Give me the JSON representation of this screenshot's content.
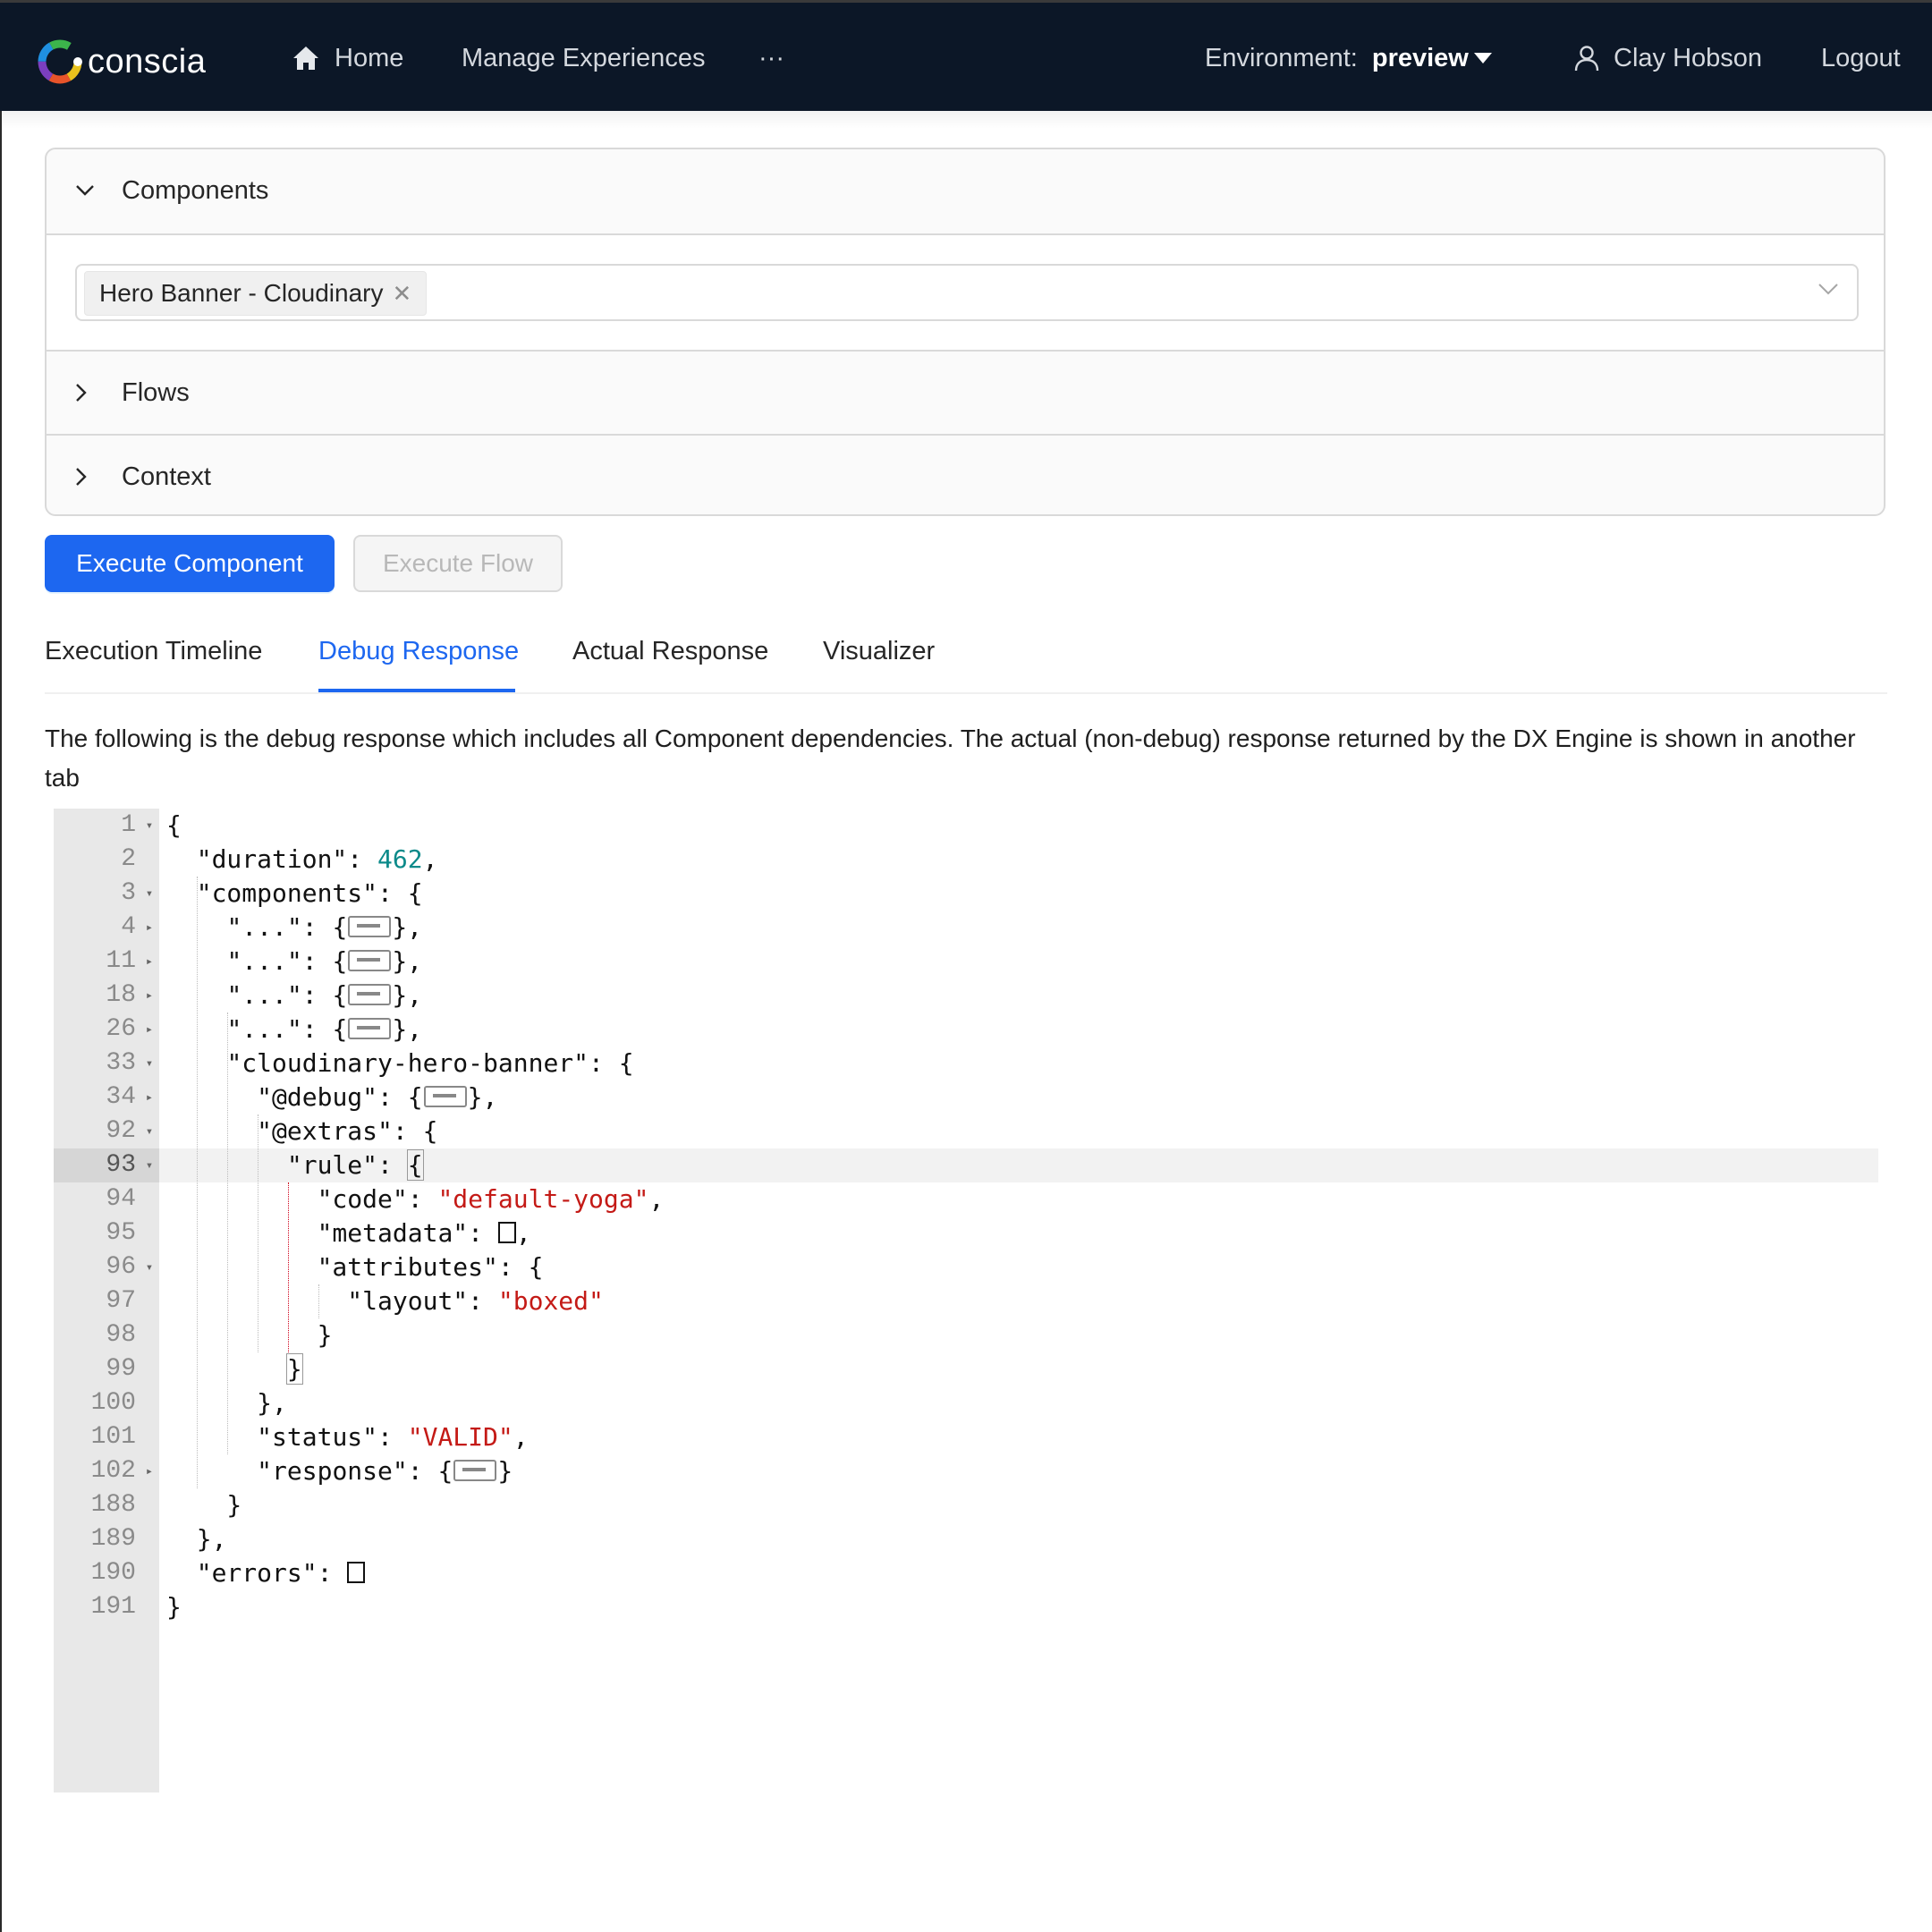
{
  "nav": {
    "brand": "conscia",
    "home": "Home",
    "manage": "Manage Experiences",
    "more": "···",
    "env_label": "Environment:",
    "env_value": "preview",
    "user": "Clay Hobson",
    "logout": "Logout"
  },
  "panels": {
    "components": "Components",
    "flows": "Flows",
    "context": "Context",
    "selected_tag": "Hero Banner - Cloudinary"
  },
  "buttons": {
    "execute_component": "Execute Component",
    "execute_flow": "Execute Flow"
  },
  "tabs": [
    {
      "label": "Execution Timeline",
      "active": false
    },
    {
      "label": "Debug Response",
      "active": true
    },
    {
      "label": "Actual Response",
      "active": false
    },
    {
      "label": "Visualizer",
      "active": false
    }
  ],
  "description": "The following is the debug response which includes all Component dependencies. The actual (non-debug) response returned by the DX Engine is shown in another tab",
  "editor": {
    "active_line": "93",
    "lines": [
      {
        "n": "1",
        "fold": "open"
      },
      {
        "n": "2",
        "fold": ""
      },
      {
        "n": "3",
        "fold": "open"
      },
      {
        "n": "4",
        "fold": "closed"
      },
      {
        "n": "11",
        "fold": "closed"
      },
      {
        "n": "18",
        "fold": "closed"
      },
      {
        "n": "26",
        "fold": "closed"
      },
      {
        "n": "33",
        "fold": "open"
      },
      {
        "n": "34",
        "fold": "closed"
      },
      {
        "n": "92",
        "fold": "open"
      },
      {
        "n": "93",
        "fold": "open"
      },
      {
        "n": "94",
        "fold": ""
      },
      {
        "n": "95",
        "fold": ""
      },
      {
        "n": "96",
        "fold": "open"
      },
      {
        "n": "97",
        "fold": ""
      },
      {
        "n": "98",
        "fold": ""
      },
      {
        "n": "99",
        "fold": ""
      },
      {
        "n": "100",
        "fold": ""
      },
      {
        "n": "101",
        "fold": ""
      },
      {
        "n": "102",
        "fold": "closed"
      },
      {
        "n": "188",
        "fold": ""
      },
      {
        "n": "189",
        "fold": ""
      },
      {
        "n": "190",
        "fold": ""
      },
      {
        "n": "191",
        "fold": ""
      }
    ],
    "text": {
      "k_duration": "\"duration\"",
      "v_duration": "462",
      "k_components": "\"components\"",
      "k_ellipsis": "\"...\"",
      "k_cloudinary": "\"cloudinary-hero-banner\"",
      "k_debug": "\"@debug\"",
      "k_extras": "\"@extras\"",
      "k_rule": "\"rule\"",
      "k_code": "\"code\"",
      "v_code": "\"default-yoga\"",
      "k_metadata": "\"metadata\"",
      "k_attributes": "\"attributes\"",
      "k_layout": "\"layout\"",
      "v_layout": "\"boxed\"",
      "k_status": "\"status\"",
      "v_status": "\"VALID\"",
      "k_response": "\"response\"",
      "k_errors": "\"errors\""
    }
  },
  "colors": {
    "nav_bg": "#0c1727",
    "primary": "#1d67f0",
    "string": "#c41a16",
    "number": "#0c8a8a"
  }
}
